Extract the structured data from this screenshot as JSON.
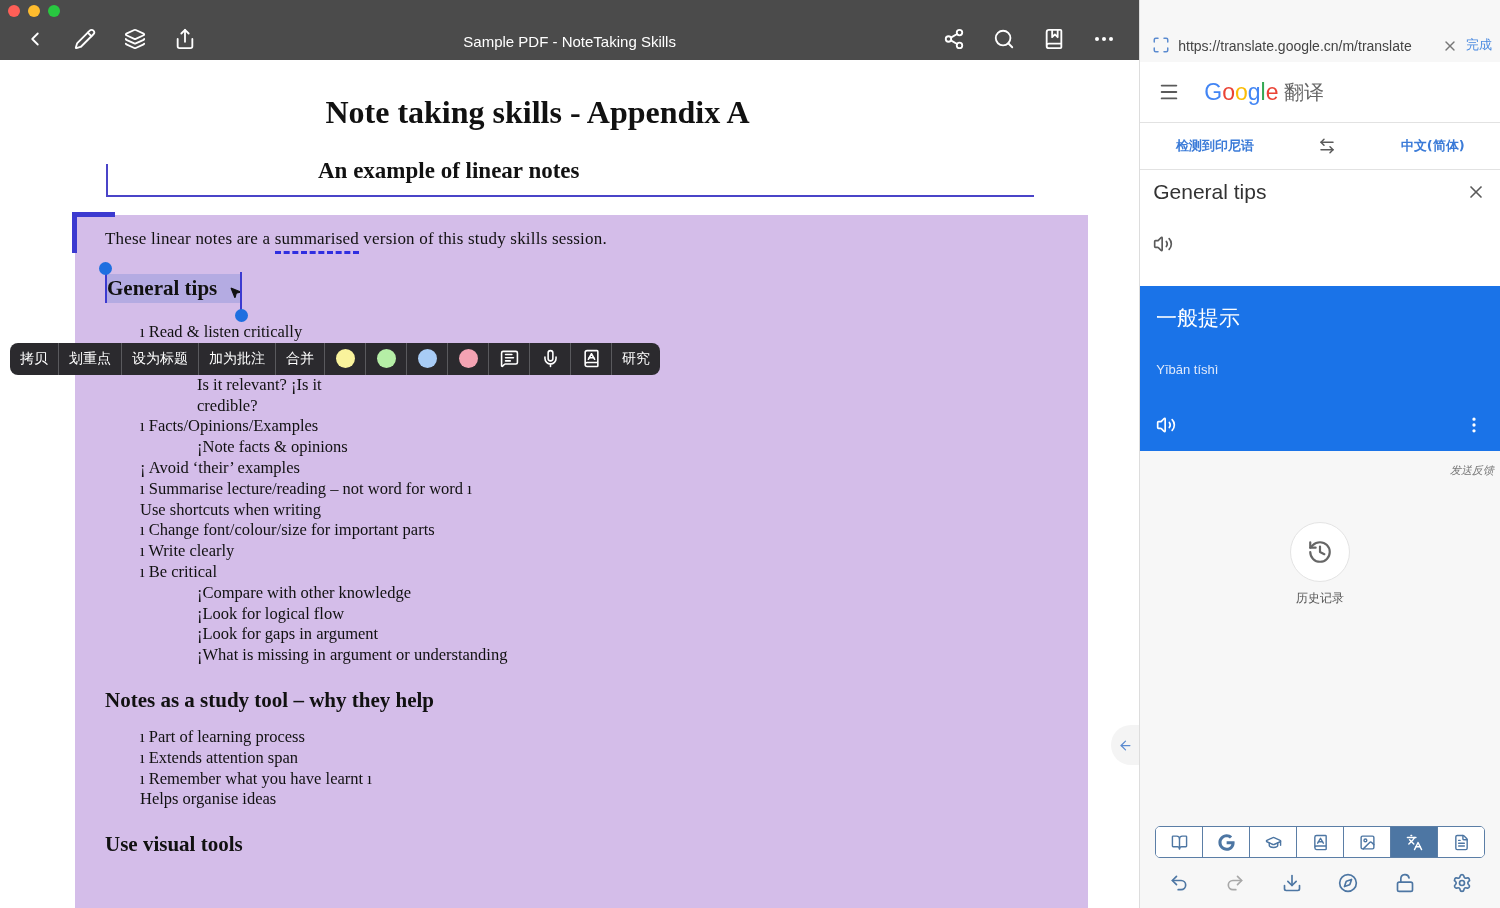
{
  "window": {
    "title": "Sample PDF - NoteTaking Skills"
  },
  "document": {
    "title": "Note taking skills - Appendix A",
    "subtitle": "An example of linear notes",
    "intro": {
      "before": "These linear notes are a ",
      "marked": "summarised",
      "after": " version of this study skills session."
    },
    "selection": {
      "text": "General tips",
      "selected": true
    },
    "tips": [
      {
        "text": "ı Read & listen critically"
      },
      {
        "children": [
          {
            "text": "Is it relevant?   ¡Is it"
          },
          {
            "text": "credible?"
          }
        ]
      },
      {
        "text": "ı Facts/Opinions/Examples",
        "children": [
          {
            "text": "¡Note facts & opinions"
          }
        ]
      },
      {
        "text": "¡   Avoid ‘their’ examples"
      },
      {
        "text": "ı Summarise lecture/reading – not word for word ı"
      },
      {
        "text": "Use shortcuts when writing"
      },
      {
        "text": "ı Change font/colour/size for important parts"
      },
      {
        "text": "ı Write clearly"
      },
      {
        "text": "ı Be critical",
        "children": [
          {
            "text": "¡Compare with other knowledge"
          },
          {
            "text": "¡Look for logical flow"
          },
          {
            "text": "¡Look for gaps in argument"
          },
          {
            "text": "¡What is missing in argument or understanding"
          }
        ]
      }
    ],
    "sections": [
      {
        "heading": "Notes as a study tool – why they help",
        "items": [
          "ı Part of learning process",
          "ı Extends attention span",
          "ı Remember what you have learnt ı",
          "Helps organise ideas"
        ]
      },
      {
        "heading": "Use visual tools"
      }
    ]
  },
  "context_menu": [
    {
      "kind": "text",
      "label": "拷贝"
    },
    {
      "kind": "text",
      "label": "划重点"
    },
    {
      "kind": "text",
      "label": "设为标题"
    },
    {
      "kind": "text",
      "label": "加为批注"
    },
    {
      "kind": "text",
      "label": "合并"
    },
    {
      "kind": "color",
      "color": "#f9f39c"
    },
    {
      "kind": "color",
      "color": "#b5eea6"
    },
    {
      "kind": "color",
      "color": "#a8ccf6"
    },
    {
      "kind": "color",
      "color": "#f4a3b3"
    },
    {
      "kind": "icon"
    },
    {
      "kind": "icon"
    },
    {
      "kind": "icon"
    },
    {
      "kind": "text",
      "label": "研究"
    }
  ],
  "browser": {
    "url": "https://translate.google.cn/m/translate",
    "done": "完成"
  },
  "translate": {
    "brand": "Google",
    "product": "翻译",
    "source_lang": "检测到印尼语",
    "target_lang": "中文(简体)",
    "source_text": "General tips",
    "result": "一般提示",
    "romanization": "Yībān tíshì",
    "feedback": "发送反馈",
    "history": "历史记录"
  },
  "tools": [
    {
      "selected": false
    },
    {
      "selected": false
    },
    {
      "selected": false
    },
    {
      "selected": false
    },
    {
      "selected": false
    },
    {
      "selected": true
    },
    {
      "selected": false
    }
  ],
  "actions": [
    {
      "disabled": false
    },
    {
      "disabled": true
    },
    {
      "disabled": false
    },
    {
      "disabled": false
    },
    {
      "disabled": false
    },
    {
      "disabled": false
    }
  ]
}
